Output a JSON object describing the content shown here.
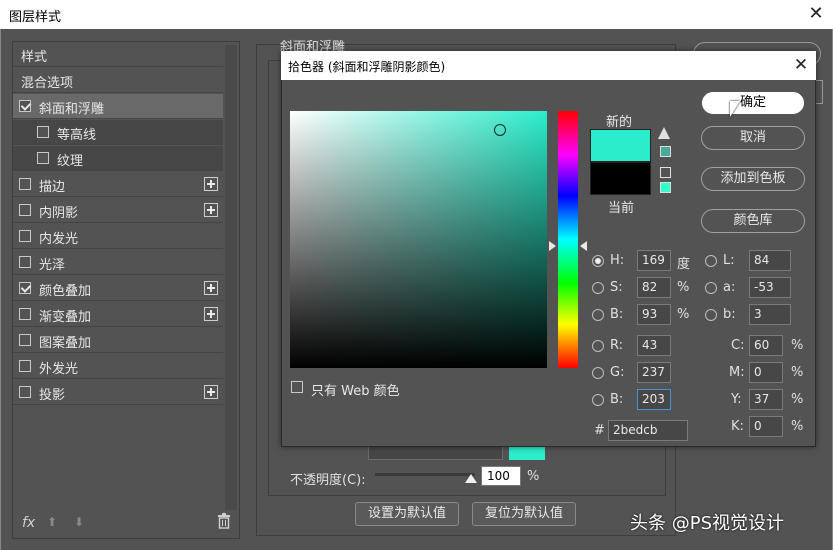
{
  "outer_window": {
    "title": "图层样式",
    "close_glyph": "✕"
  },
  "style_list": {
    "items": [
      {
        "label": "样式",
        "checkbox": false,
        "checked": false,
        "plus": false,
        "kind": "header"
      },
      {
        "label": "混合选项",
        "checkbox": false,
        "checked": false,
        "plus": false,
        "kind": "header"
      },
      {
        "label": "斜面和浮雕",
        "checkbox": true,
        "checked": true,
        "plus": false,
        "kind": "selected"
      },
      {
        "label": "等高线",
        "checkbox": true,
        "checked": false,
        "plus": false,
        "kind": "sub"
      },
      {
        "label": "纹理",
        "checkbox": true,
        "checked": false,
        "plus": false,
        "kind": "sub"
      },
      {
        "label": "描边",
        "checkbox": true,
        "checked": false,
        "plus": true,
        "kind": "normal"
      },
      {
        "label": "内阴影",
        "checkbox": true,
        "checked": false,
        "plus": true,
        "kind": "normal"
      },
      {
        "label": "内发光",
        "checkbox": true,
        "checked": false,
        "plus": false,
        "kind": "normal"
      },
      {
        "label": "光泽",
        "checkbox": true,
        "checked": false,
        "plus": false,
        "kind": "normal"
      },
      {
        "label": "颜色叠加",
        "checkbox": true,
        "checked": true,
        "plus": true,
        "kind": "normal"
      },
      {
        "label": "渐变叠加",
        "checkbox": true,
        "checked": false,
        "plus": true,
        "kind": "normal"
      },
      {
        "label": "图案叠加",
        "checkbox": true,
        "checked": false,
        "plus": false,
        "kind": "normal"
      },
      {
        "label": "外发光",
        "checkbox": true,
        "checked": false,
        "plus": false,
        "kind": "normal"
      },
      {
        "label": "投影",
        "checkbox": true,
        "checked": false,
        "plus": true,
        "kind": "normal"
      }
    ],
    "footer": {
      "fx": "fx",
      "up": "⬆",
      "down": "⬇"
    }
  },
  "bevel_panel": {
    "title": "斜面和浮雕",
    "opacity_label": "不透明度(C):",
    "opacity_value": "100",
    "opacity_unit": "%",
    "set_default_label": "设置为默认值",
    "reset_default_label": "复位为默认值"
  },
  "color_picker": {
    "title": "拾色器 (斜面和浮雕阴影颜色)",
    "close_glyph": "✕",
    "new_label": "新的",
    "current_label": "当前",
    "new_color": "#2bedcb",
    "current_color": "#000000",
    "buttons": {
      "ok": "确定",
      "cancel": "取消",
      "add_to_swatches": "添加到色板",
      "color_libraries": "颜色库"
    },
    "web_only_label": "只有 Web 颜色",
    "fields": {
      "H": {
        "label": "H:",
        "value": "169",
        "unit": "度"
      },
      "S": {
        "label": "S:",
        "value": "82",
        "unit": "%"
      },
      "Bv": {
        "label": "B:",
        "value": "93",
        "unit": "%"
      },
      "R": {
        "label": "R:",
        "value": "43"
      },
      "G": {
        "label": "G:",
        "value": "237"
      },
      "Bc": {
        "label": "B:",
        "value": "203"
      },
      "L": {
        "label": "L:",
        "value": "84"
      },
      "a": {
        "label": "a:",
        "value": "-53"
      },
      "b": {
        "label": "b:",
        "value": "3"
      },
      "C": {
        "label": "C:",
        "value": "60",
        "unit": "%"
      },
      "M": {
        "label": "M:",
        "value": "0",
        "unit": "%"
      },
      "Y": {
        "label": "Y:",
        "value": "37",
        "unit": "%"
      },
      "K": {
        "label": "K:",
        "value": "0",
        "unit": "%"
      }
    },
    "hex_hash": "#",
    "hex_value": "2bedcb"
  },
  "watermark": "头条 @PS视觉设计"
}
